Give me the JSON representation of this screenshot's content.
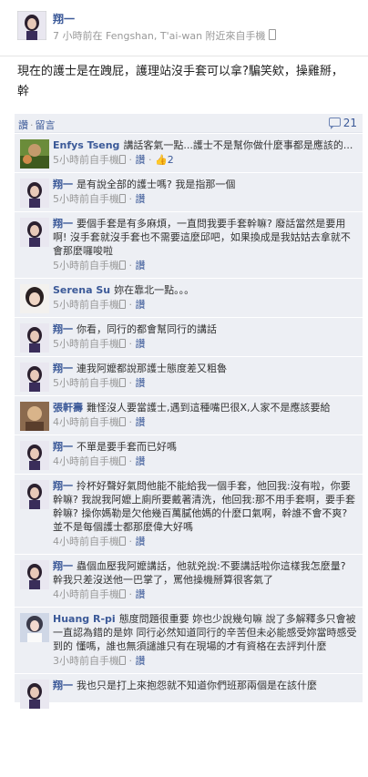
{
  "post": {
    "author": "翔一",
    "meta": "7 小時前在 Fengshan, T'ai-wan 附近來自手機",
    "text": "現在的護士是在跩屁，護理站沒手套可以拿?騙笑欸，操雞掰，幹",
    "like_label": "讚",
    "comment_label": "留言",
    "comment_count": "21"
  },
  "comments": [
    {
      "name": "Enfys Tseng",
      "text": "講話客氣一點...護士不是幫你做什麼事都是應該的...",
      "time": "5小時前",
      "via": "自手機",
      "like": "讚",
      "likes": "2"
    },
    {
      "name": "翔一",
      "text": "是有說全部的護士嗎? 我是指那一個",
      "time": "5小時前",
      "via": "自手機",
      "like": "讚"
    },
    {
      "name": "翔一",
      "text": "要個手套是有多麻煩，一直問我要手套幹嘛? 廢話當然是要用啊! 沒手套就沒手套也不需要這麼邱吧，如果換成是我姑姑去拿就不會那麼囉唆啦",
      "time": "5小時前",
      "via": "自手機",
      "like": "讚"
    },
    {
      "name": "Serena Su",
      "text": "妳在靠北一點。。。",
      "time": "5小時前",
      "via": "自手機",
      "like": "讚"
    },
    {
      "name": "翔一",
      "text": "你看，同行的都會幫同行的講話",
      "time": "5小時前",
      "via": "自手機",
      "like": "讚"
    },
    {
      "name": "翔一",
      "text": "連我阿嬤都說那護士態度差又粗魯",
      "time": "5小時前",
      "via": "自手機",
      "like": "讚"
    },
    {
      "name": "張軒壽",
      "text": "難怪沒人要當護士,遇到這種嘴巴很X,人家不是應該要給",
      "time": "4小時前",
      "via": "自手機",
      "like": "讚"
    },
    {
      "name": "翔一",
      "text": "不單是要手套而已好嗎",
      "time": "4小時前",
      "via": "自手機",
      "like": "讚"
    },
    {
      "name": "翔一",
      "text": "拎杯好聲好氣問他能不能給我一個手套，他回我:沒有啦，你要幹嘛? 我說我阿嬤上廁所要戴著清洗，他回我:那不用手套啊，要手套幹嘛? 操你媽勒是欠他幾百萬膩他媽的什麼口氣啊，幹誰不會不爽? 並不是每個護士都那麼偉大好嗎",
      "time": "4小時前",
      "via": "自手機",
      "like": "讚"
    },
    {
      "name": "翔一",
      "text": "蟲個血壓我阿嬤講話，他就兇說:不要講話啦你這樣我怎麼量? 幹我只差沒送他一巴掌了，罵他操機掰算很客氣了",
      "time": "4小時前",
      "via": "自手機",
      "like": "讚"
    },
    {
      "name": "Huang R-pi",
      "text": "態度問題很重要 妳也少說幾句嘛 說了多解釋多只會被一直認為錯的是妳 同行必然知道同行的辛苦但未必能感受妳當時感受到的 懂嗎，誰也無須譴誰只有在現場的才有資格在去評判什麼",
      "time": "3小時前",
      "via": "自手機",
      "like": "讚"
    },
    {
      "name": "翔一",
      "text": "我也只是打上來抱怨就不知道你們班那兩個是在該什麼",
      "time": "",
      "via": "",
      "like": ""
    }
  ]
}
